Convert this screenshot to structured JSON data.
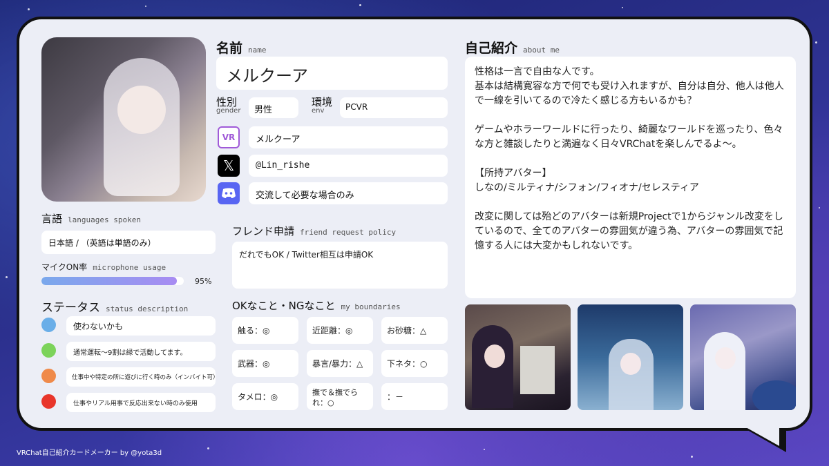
{
  "name_label": "名前",
  "name_sub": "name",
  "name_value": "メルクーア",
  "gender_label": "性別",
  "gender_sub": "gender",
  "gender_value": "男性",
  "env_label": "環境",
  "env_sub": "env",
  "env_value": "PCVR",
  "vrchat_value": "メルクーア",
  "vrchat_icon_text": "VR",
  "twitter_value": "@Lin_rishe",
  "discord_value": "交流して必要な場合のみ",
  "lang_label": "言語",
  "lang_sub": "languages spoken",
  "lang_value": "日本語 / （英語は単語のみ）",
  "mic_label": "マイクON率",
  "mic_sub": "microphone usage",
  "mic_value": "95%",
  "mic_fraction": 0.95,
  "status_label": "ステータス",
  "status_sub": "status description",
  "statuses": [
    {
      "color": "#6aaee8",
      "text": "使わないかも"
    },
    {
      "color": "#7cd35a",
      "text": "通常運転〜9割は緑で活動してます。"
    },
    {
      "color": "#ef8a4a",
      "text": "仕事中や特定の所に遊びに行く時のみ（インバイト可）"
    },
    {
      "color": "#e8352a",
      "text": "仕事やリアル用事で反応出来ない時のみ使用"
    }
  ],
  "friend_label": "フレンド申請",
  "friend_sub": "friend request policy",
  "friend_value": "だれでもOK / Twitter相互は申請OK",
  "ok_label": "OKなこと・NGなこと",
  "ok_sub": "my boundaries",
  "boundaries": [
    "触る：◎",
    "近距離：◎",
    "お砂糖：△",
    "武器：◎",
    "暴言/暴力：△",
    "下ネタ：○",
    "タメロ：◎",
    "撫で＆撫でられ：○",
    "：－"
  ],
  "about_label": "自己紹介",
  "about_sub": "about me",
  "about_lines": [
    "性格は一言で自由な人です。",
    "基本は結構寛容な方で何でも受け入れますが、自分は自分、他人は他人で一線を引いてるので冷たく感じる方もいるかも？",
    "",
    "ゲームやホラーワールドに行ったり、綺麗なワールドを巡ったり、色々な方と雑談したりと満遍なく日々VRChatを楽しんでるよ〜。",
    "",
    "【所持アバター】",
    "しなの/ミルティナ/シフォン/フィオナ/セレスティア",
    "",
    "改変に関しては殆どのアバターは新規Projectで1からジャンル改変をしているので、全てのアバターの雰囲気が違う為、アバターの雰囲気で記憶する人には大変かもしれないです。"
  ],
  "footer": "VRChat自己紹介カードメーカー by @yota3d"
}
